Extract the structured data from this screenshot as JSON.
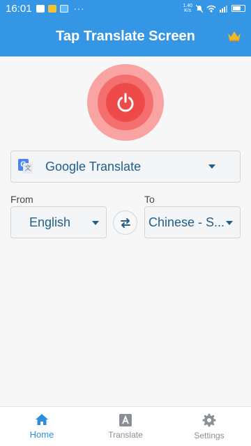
{
  "status_bar": {
    "time": "16:01",
    "dots": "···",
    "speed_top": "1.40",
    "speed_bottom": "K/s",
    "icons": [
      "image-icon",
      "shopping-bag-icon",
      "app-icon",
      "mute-icon",
      "wifi-icon",
      "signal-icon",
      "battery-icon"
    ]
  },
  "app_bar": {
    "title": "Tap Translate Screen",
    "premium_icon": "crown-icon"
  },
  "power": {
    "icon": "power-icon",
    "state": "off"
  },
  "engine": {
    "icon": "google-translate-icon",
    "label": "Google Translate"
  },
  "languages": {
    "from_label": "From",
    "to_label": "To",
    "source": "English",
    "target": "Chinese - S..."
  },
  "bottom_nav": {
    "items": [
      {
        "label": "Home",
        "icon": "home-icon",
        "active": true
      },
      {
        "label": "Translate",
        "icon": "translate-icon",
        "active": false
      },
      {
        "label": "Settings",
        "icon": "gear-icon",
        "active": false
      }
    ]
  },
  "colors": {
    "primary": "#3596e6",
    "accent_text": "#1f5f8b",
    "power_outer": "#f9a3a3",
    "power_mid": "#f66f6f",
    "power_inner": "#ef4a4a",
    "nav_active": "#2d8ee0",
    "nav_inactive": "#8a8f96",
    "crown": "#f3b623"
  }
}
